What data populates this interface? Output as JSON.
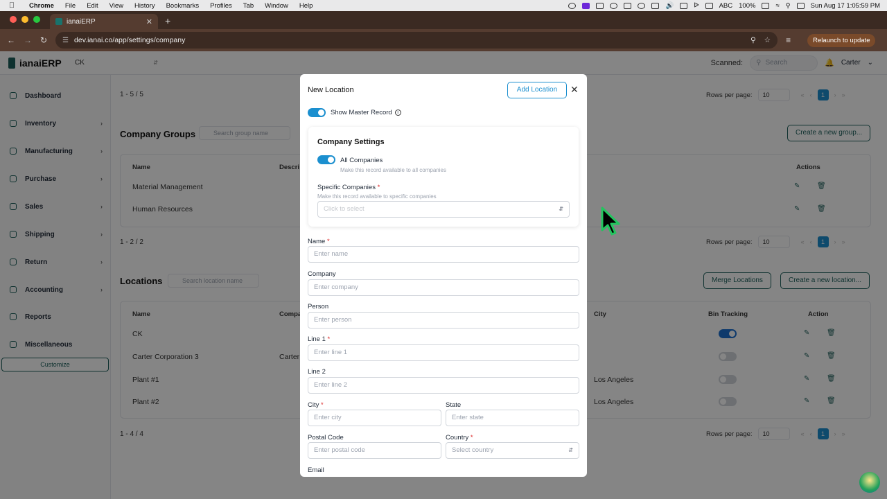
{
  "menubar": {
    "app": "Chrome",
    "items": [
      "File",
      "Edit",
      "View",
      "History",
      "Bookmarks",
      "Profiles",
      "Tab",
      "Window",
      "Help"
    ],
    "input_source": "ABC",
    "battery": "100%",
    "clock": "Sun Aug 17  1:05:59 PM"
  },
  "browser": {
    "tab_title": "ianaiERP",
    "url": "dev.ianai.co/app/settings/company",
    "relaunch_label": "Relaunch to update"
  },
  "header": {
    "brand": "ianaiERP",
    "company": "CK",
    "scanned_label": "Scanned:",
    "search_placeholder": "Search",
    "user": "Carter"
  },
  "sidebar": {
    "items": [
      {
        "label": "Dashboard",
        "chevron": false
      },
      {
        "label": "Inventory",
        "chevron": true
      },
      {
        "label": "Manufacturing",
        "chevron": true
      },
      {
        "label": "Purchase",
        "chevron": true
      },
      {
        "label": "Sales",
        "chevron": true
      },
      {
        "label": "Shipping",
        "chevron": true
      },
      {
        "label": "Return",
        "chevron": true
      },
      {
        "label": "Accounting",
        "chevron": true
      },
      {
        "label": "Reports",
        "chevron": false
      },
      {
        "label": "Miscellaneous",
        "chevron": false
      }
    ],
    "customize": "Customize"
  },
  "main": {
    "top_count": "1 - 5 / 5",
    "rows_per_page": "Rows per page:",
    "rows_value": "10",
    "page": "1",
    "groups": {
      "title": "Company Groups",
      "search_placeholder": "Search group name",
      "create_label": "Create a new group...",
      "col_name": "Name",
      "col_desc": "Descri",
      "col_actions": "Actions",
      "rows": [
        "Material Management",
        "Human Resources"
      ],
      "count": "1 - 2 / 2"
    },
    "locations": {
      "title": "Locations",
      "search_placeholder": "Search location name",
      "merge_label": "Merge Locations",
      "create_label": "Create a new location...",
      "col_name": "Name",
      "col_company": "Compa",
      "col_city": "City",
      "col_bin": "Bin Tracking",
      "col_action": "Action",
      "rows": [
        {
          "name": "CK",
          "company": "",
          "city": "",
          "bin": true
        },
        {
          "name": "Carter Corporation 3",
          "company": "Carter",
          "city": "",
          "bin": false
        },
        {
          "name": "Plant #1",
          "company": "",
          "city": "Los Angeles",
          "bin": false
        },
        {
          "name": "Plant #2",
          "company": "",
          "city": "Los Angeles",
          "bin": false
        }
      ],
      "count": "1 - 4 / 4"
    }
  },
  "modal": {
    "title": "New Location",
    "add_label": "Add Location",
    "show_master": "Show Master Record",
    "company_settings": {
      "title": "Company Settings",
      "all_companies": "All Companies",
      "all_companies_hint": "Make this record available to all companies",
      "specific_label": "Specific Companies",
      "specific_hint": "Make this record available to specific companies",
      "specific_placeholder": "Click to select"
    },
    "fields": {
      "name_label": "Name",
      "name_ph": "Enter name",
      "company_label": "Company",
      "company_ph": "Enter company",
      "person_label": "Person",
      "person_ph": "Enter person",
      "line1_label": "Line 1",
      "line1_ph": "Enter line 1",
      "line2_label": "Line 2",
      "line2_ph": "Enter line 2",
      "city_label": "City",
      "city_ph": "Enter city",
      "state_label": "State",
      "state_ph": "Enter state",
      "postal_label": "Postal Code",
      "postal_ph": "Enter postal code",
      "country_label": "Country",
      "country_ph": "Select country",
      "email_label": "Email"
    },
    "required_mark": "*"
  },
  "colors": {
    "accent": "#1b8fcf",
    "brand": "#1b5e5a",
    "cursor": "#22c55e"
  }
}
